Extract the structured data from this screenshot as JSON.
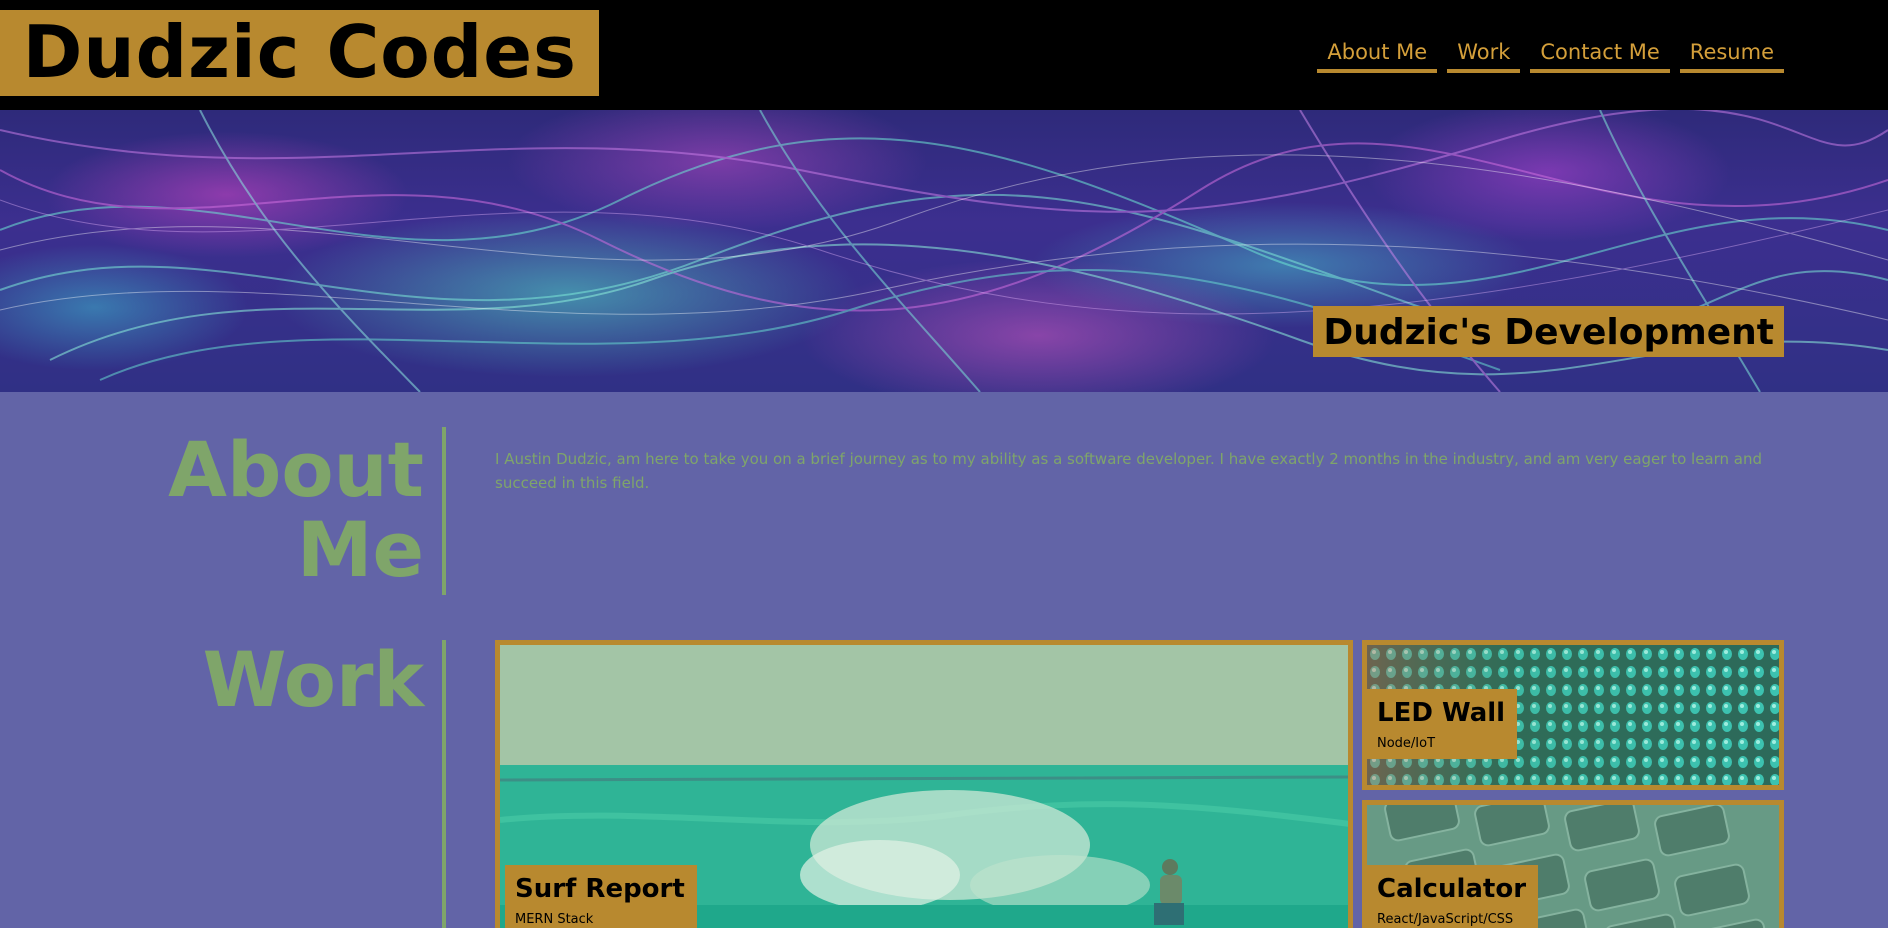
{
  "header": {
    "logo": "Dudzic Codes",
    "nav": [
      {
        "label": "About Me"
      },
      {
        "label": "Work"
      },
      {
        "label": "Contact Me"
      },
      {
        "label": "Resume"
      }
    ]
  },
  "hero": {
    "badge": "Dudzic's Development"
  },
  "about": {
    "title_line1": "About",
    "title_line2": "Me",
    "text": "I Austin Dudzic, am here to take you on a brief journey as to my ability as a software developer. I have exactly 2 months in the industry, and am very eager to learn and succeed in this field."
  },
  "work": {
    "title": "Work",
    "projects": [
      {
        "title": "Surf Report",
        "stack": "MERN Stack"
      },
      {
        "title": "LED Wall",
        "stack": "Node/IoT"
      },
      {
        "title": "Calculator",
        "stack": "React/JavaScript/CSS"
      }
    ]
  },
  "colors": {
    "page_bg": "#6264a7",
    "header_bg": "#000000",
    "accent_gold": "#b8892f",
    "nav_text": "#d49f3a",
    "section_green": "#7fa56a"
  }
}
